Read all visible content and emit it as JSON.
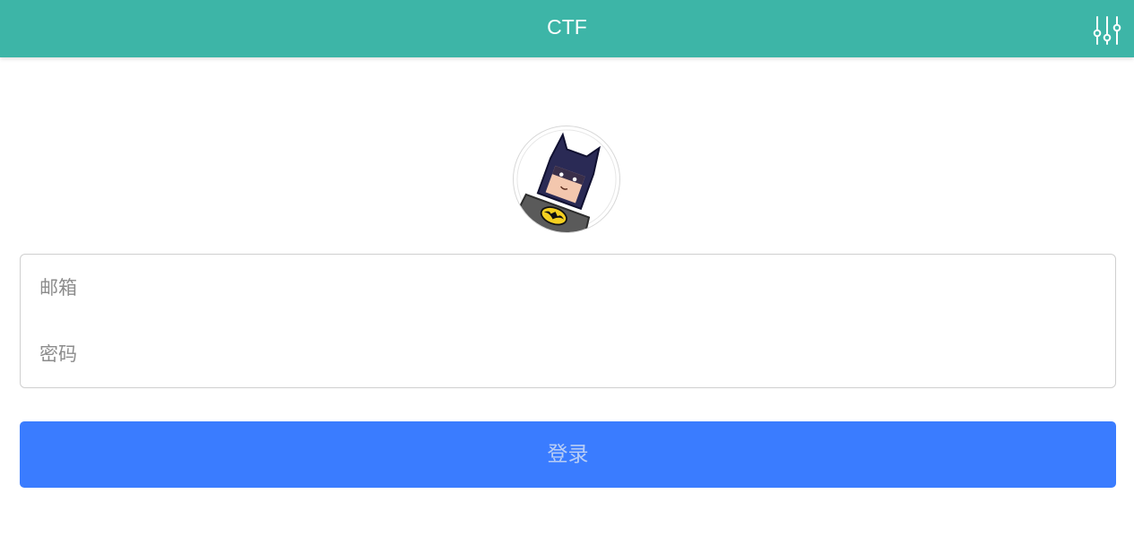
{
  "header": {
    "title": "CTF",
    "settings_icon": "sliders-icon",
    "background_color": "#3db5a7"
  },
  "avatar": {
    "icon": "batman-avatar"
  },
  "form": {
    "email_placeholder": "邮箱",
    "email_value": "",
    "password_placeholder": "密码",
    "password_value": ""
  },
  "login_button": {
    "label": "登录",
    "color": "#3a7cff"
  }
}
